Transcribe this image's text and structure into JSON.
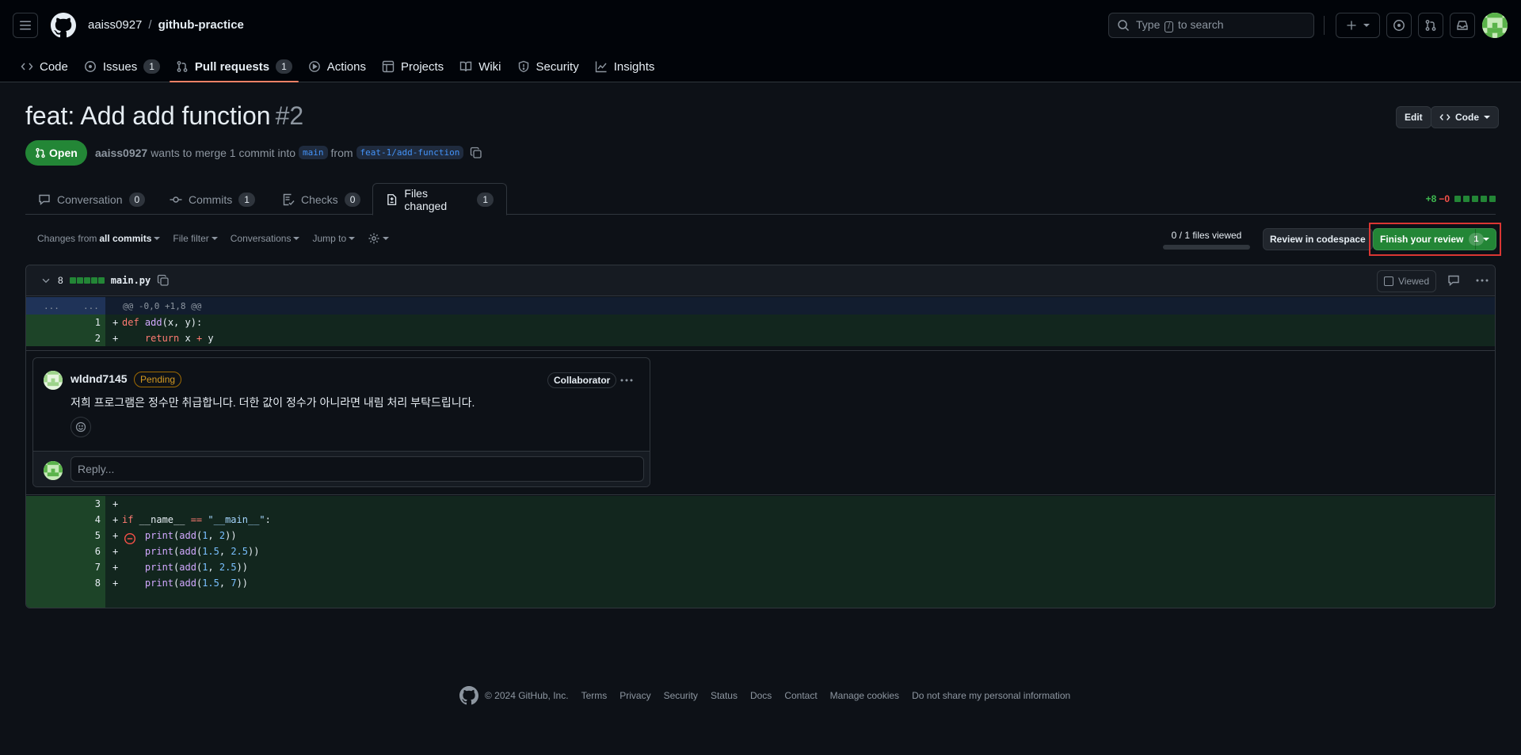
{
  "header": {
    "repo_owner": "aaiss0927",
    "separator": "/",
    "repo_name": "github-practice",
    "search": {
      "prefix": "Type",
      "key": "/",
      "suffix": "to search"
    }
  },
  "nav": {
    "code": "Code",
    "issues": "Issues",
    "issues_count": "1",
    "pulls": "Pull requests",
    "pulls_count": "1",
    "actions": "Actions",
    "projects": "Projects",
    "wiki": "Wiki",
    "security": "Security",
    "insights": "Insights"
  },
  "pr": {
    "title": "feat: Add add function",
    "number": "#2",
    "edit_label": "Edit",
    "code_label": "Code",
    "state": "Open",
    "author": "aaiss0927",
    "meta_text": "wants to merge 1 commit into",
    "base_branch": "main",
    "from_text": "from",
    "head_branch": "feat-1/add-function"
  },
  "tabs": {
    "conversation": "Conversation",
    "conversation_count": "0",
    "commits": "Commits",
    "commits_count": "1",
    "checks": "Checks",
    "checks_count": "0",
    "files": "Files changed",
    "files_count": "1"
  },
  "diffstat": {
    "additions": "+8",
    "deletions": "−0"
  },
  "toolbar": {
    "changes_prefix": "Changes from",
    "changes_value": "all commits",
    "file_filter": "File filter",
    "conversations": "Conversations",
    "jump_to": "Jump to",
    "files_viewed": "0 / 1 files viewed",
    "review_codespace": "Review in codespace",
    "finish_review": "Finish your review",
    "finish_count": "1"
  },
  "file": {
    "changes_count": "8",
    "name": "main.py",
    "viewed_label": "Viewed",
    "hunk_dots_left": "...",
    "hunk_dots_right": "...",
    "hunk_header": "@@ -0,0 +1,8 @@",
    "lines": [
      {
        "num": "1",
        "sign": "+"
      },
      {
        "num": "2",
        "sign": "+"
      },
      {
        "num": "3",
        "sign": "+"
      },
      {
        "num": "4",
        "sign": "+"
      },
      {
        "num": "5",
        "sign": "+"
      },
      {
        "num": "6",
        "sign": "+"
      },
      {
        "num": "7",
        "sign": "+"
      },
      {
        "num": "8",
        "sign": "+"
      }
    ]
  },
  "comment": {
    "author": "wldnd7145",
    "pending_label": "Pending",
    "role": "Collaborator",
    "body": "저희 프로그램은 정수만 취급합니다. 더한 값이 정수가 아니라면 내림 처리 부탁드립니다.",
    "reply_placeholder": "Reply..."
  },
  "footer": {
    "copyright": "© 2024 GitHub, Inc.",
    "links": [
      "Terms",
      "Privacy",
      "Security",
      "Status",
      "Docs",
      "Contact",
      "Manage cookies",
      "Do not share my personal information"
    ]
  },
  "colors": {
    "accent_green": "#238636",
    "highlight_red": "#da3633",
    "pending_orange": "#d29922",
    "underline_orange": "#f78166"
  },
  "icons": [
    "hamburger-icon",
    "github-logo-icon",
    "search-icon",
    "plus-icon",
    "issue-icon",
    "pull-request-icon",
    "inbox-icon",
    "code-icon",
    "play-icon",
    "table-icon",
    "book-icon",
    "shield-icon",
    "graph-icon",
    "comment-icon",
    "commit-icon",
    "checklist-icon",
    "file-diff-icon",
    "gear-icon",
    "copy-icon",
    "kebab-icon",
    "smiley-icon",
    "remove-icon"
  ]
}
